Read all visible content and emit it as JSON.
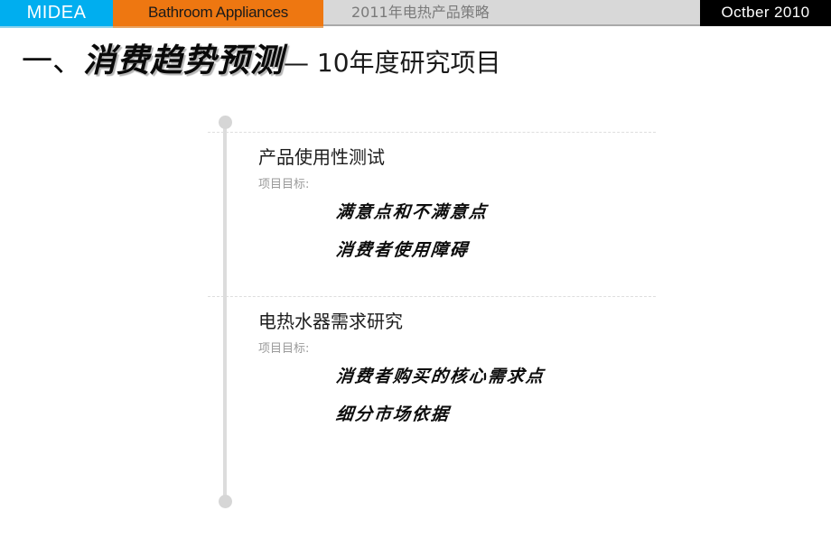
{
  "header": {
    "brand": "MIDEA",
    "category": "Bathroom Appliances",
    "document_title": "2011年电热产品策略",
    "date": "Octber  2010",
    "colors": {
      "brand_blue": "#00aeef",
      "category_orange": "#ee7711",
      "doc_gray": "#d8d8d8",
      "date_black": "#000000"
    }
  },
  "title": {
    "number": "一、",
    "main": "消费趋势预测",
    "subtitle": "— 10年度研究项目"
  },
  "timeline": {
    "top_dot": "timeline-node",
    "bottom_dot": "timeline-node"
  },
  "sections": [
    {
      "heading": "产品使用性测试",
      "goal_label": "项目目标:",
      "items": [
        "满意点和不满意点",
        "消费者使用障碍"
      ]
    },
    {
      "heading": "电热水器需求研究",
      "goal_label": "项目目标:",
      "items": [
        "消费者购买的核心需求点",
        "细分市场依据"
      ]
    }
  ]
}
